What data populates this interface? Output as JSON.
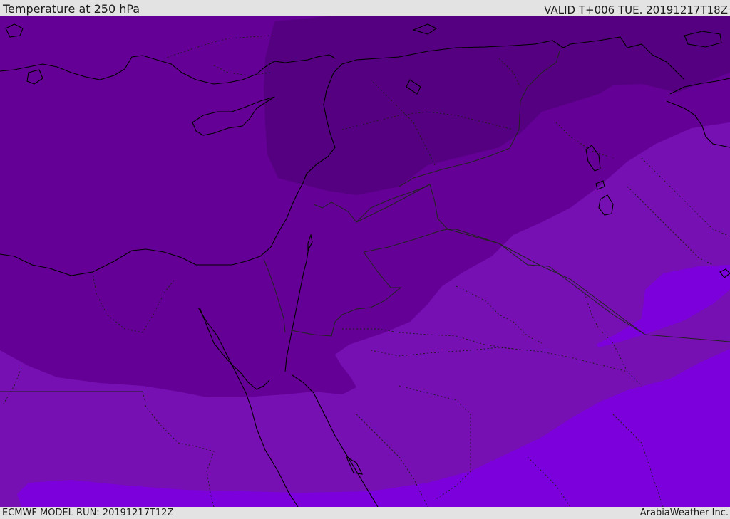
{
  "header": {
    "title": "Temperature at 250 hPa",
    "valid_time": "VALID T+006 TUE. 20191217T18Z"
  },
  "footer": {
    "model_run": "ECMWF MODEL RUN: 20191217T12Z",
    "credit": "ArabiaWeather Inc."
  },
  "colors": {
    "band_coldest": "#550080",
    "band_cold": "#650096",
    "band_mild": "#7610b2",
    "band_warmest": "#7c00dc",
    "coastline": "#000000",
    "border": "#222222"
  }
}
